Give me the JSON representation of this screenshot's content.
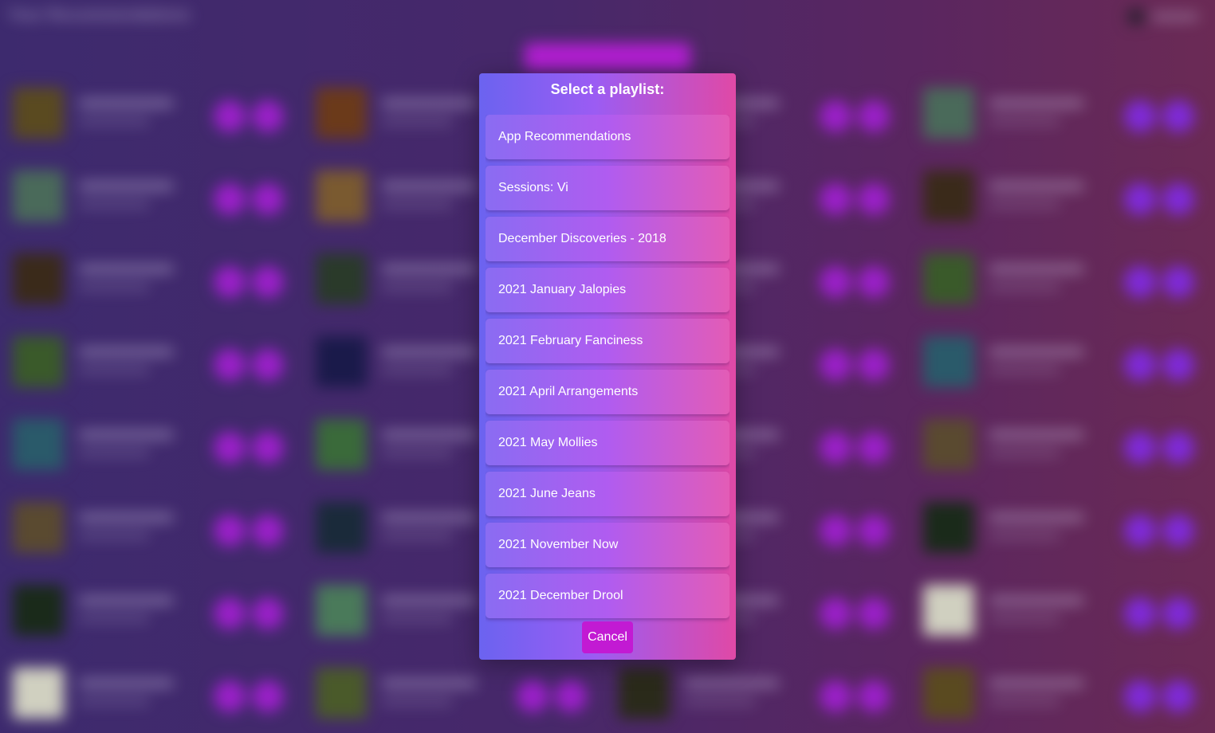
{
  "background": {
    "header_title": "Your Recommendations"
  },
  "dialog": {
    "title": "Select a playlist:",
    "playlists": [
      "App Recommendations",
      "Sessions: Vi",
      "December Discoveries - 2018",
      "2021 January Jalopies",
      "2021 February Fanciness",
      "2021 April Arrangements",
      "2021 May Mollies",
      "2021 June Jeans",
      "2021 November Now",
      "2021 December Drool"
    ],
    "cancel_label": "Cancel"
  },
  "colors": {
    "cancel": "#c21ad3",
    "gradient_start": "#6b63f0",
    "gradient_end": "#e049a6"
  }
}
